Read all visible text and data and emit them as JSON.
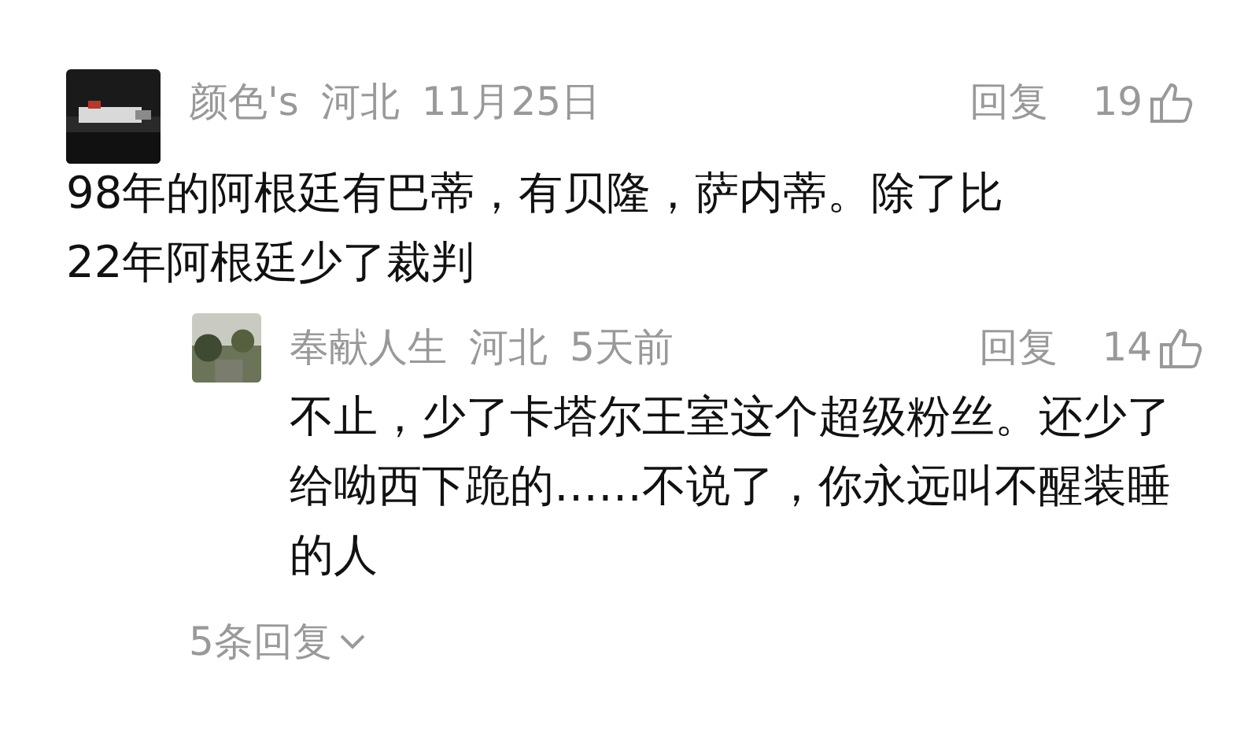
{
  "comment": {
    "author": "颜色's",
    "location": "河北",
    "date": "11月25日",
    "reply_label": "回复",
    "likes": "19",
    "text": "98年的阿根廷有巴蒂，有贝隆，萨内蒂。除了比22年阿根廷少了裁判",
    "replies": [
      {
        "author": "奉献人生",
        "location": "河北",
        "date": "5天前",
        "reply_label": "回复",
        "likes": "14",
        "text": "不止，少了卡塔尔王室这个超级粉丝。还少了给呦西下跪的……不说了，你永远叫不醒装睡的人"
      }
    ]
  },
  "more_replies": "5条回复"
}
